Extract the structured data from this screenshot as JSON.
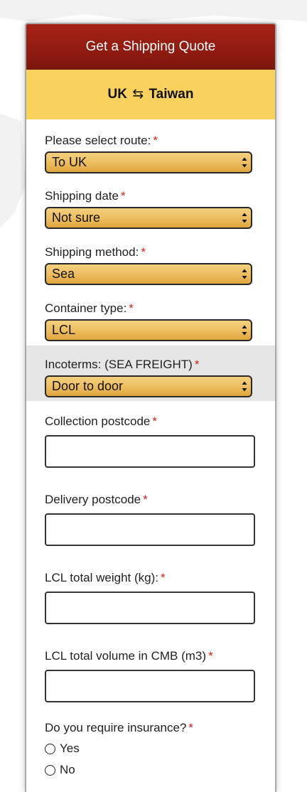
{
  "form": {
    "title": "Get a Shipping Quote",
    "route_from": "UK",
    "route_arrow": "⇆",
    "route_to": "Taiwan",
    "required_mark": "*"
  },
  "fields": {
    "route": {
      "label": "Please select route:",
      "value": "To UK"
    },
    "shipping_date": {
      "label": "Shipping date",
      "value": "Not sure"
    },
    "shipping_method": {
      "label": "Shipping method:",
      "value": "Sea"
    },
    "container_type": {
      "label": "Container type:",
      "value": "LCL"
    },
    "incoterms": {
      "label": "Incoterms: (SEA FREIGHT)",
      "value": "Door to door"
    },
    "collection_postcode": {
      "label": "Collection postcode",
      "value": ""
    },
    "delivery_postcode": {
      "label": "Delivery postcode",
      "value": ""
    },
    "lcl_weight": {
      "label": "LCL total weight (kg):",
      "value": ""
    },
    "lcl_volume": {
      "label": "LCL total volume in CMB (m3)",
      "value": ""
    },
    "insurance": {
      "label": "Do you require insurance?",
      "options": [
        "Yes",
        "No"
      ]
    }
  },
  "colors": {
    "header_red": "#8c1a10",
    "route_yellow": "#f8d25c",
    "select_gold": "#eec164",
    "required_red": "#d4201a",
    "incoterms_band": "#e6e6e6"
  },
  "icons": {
    "select_arrow": "updown-chevron-icon",
    "route_arrow": "swap-arrows-icon",
    "radio": "radio-circle-icon"
  }
}
